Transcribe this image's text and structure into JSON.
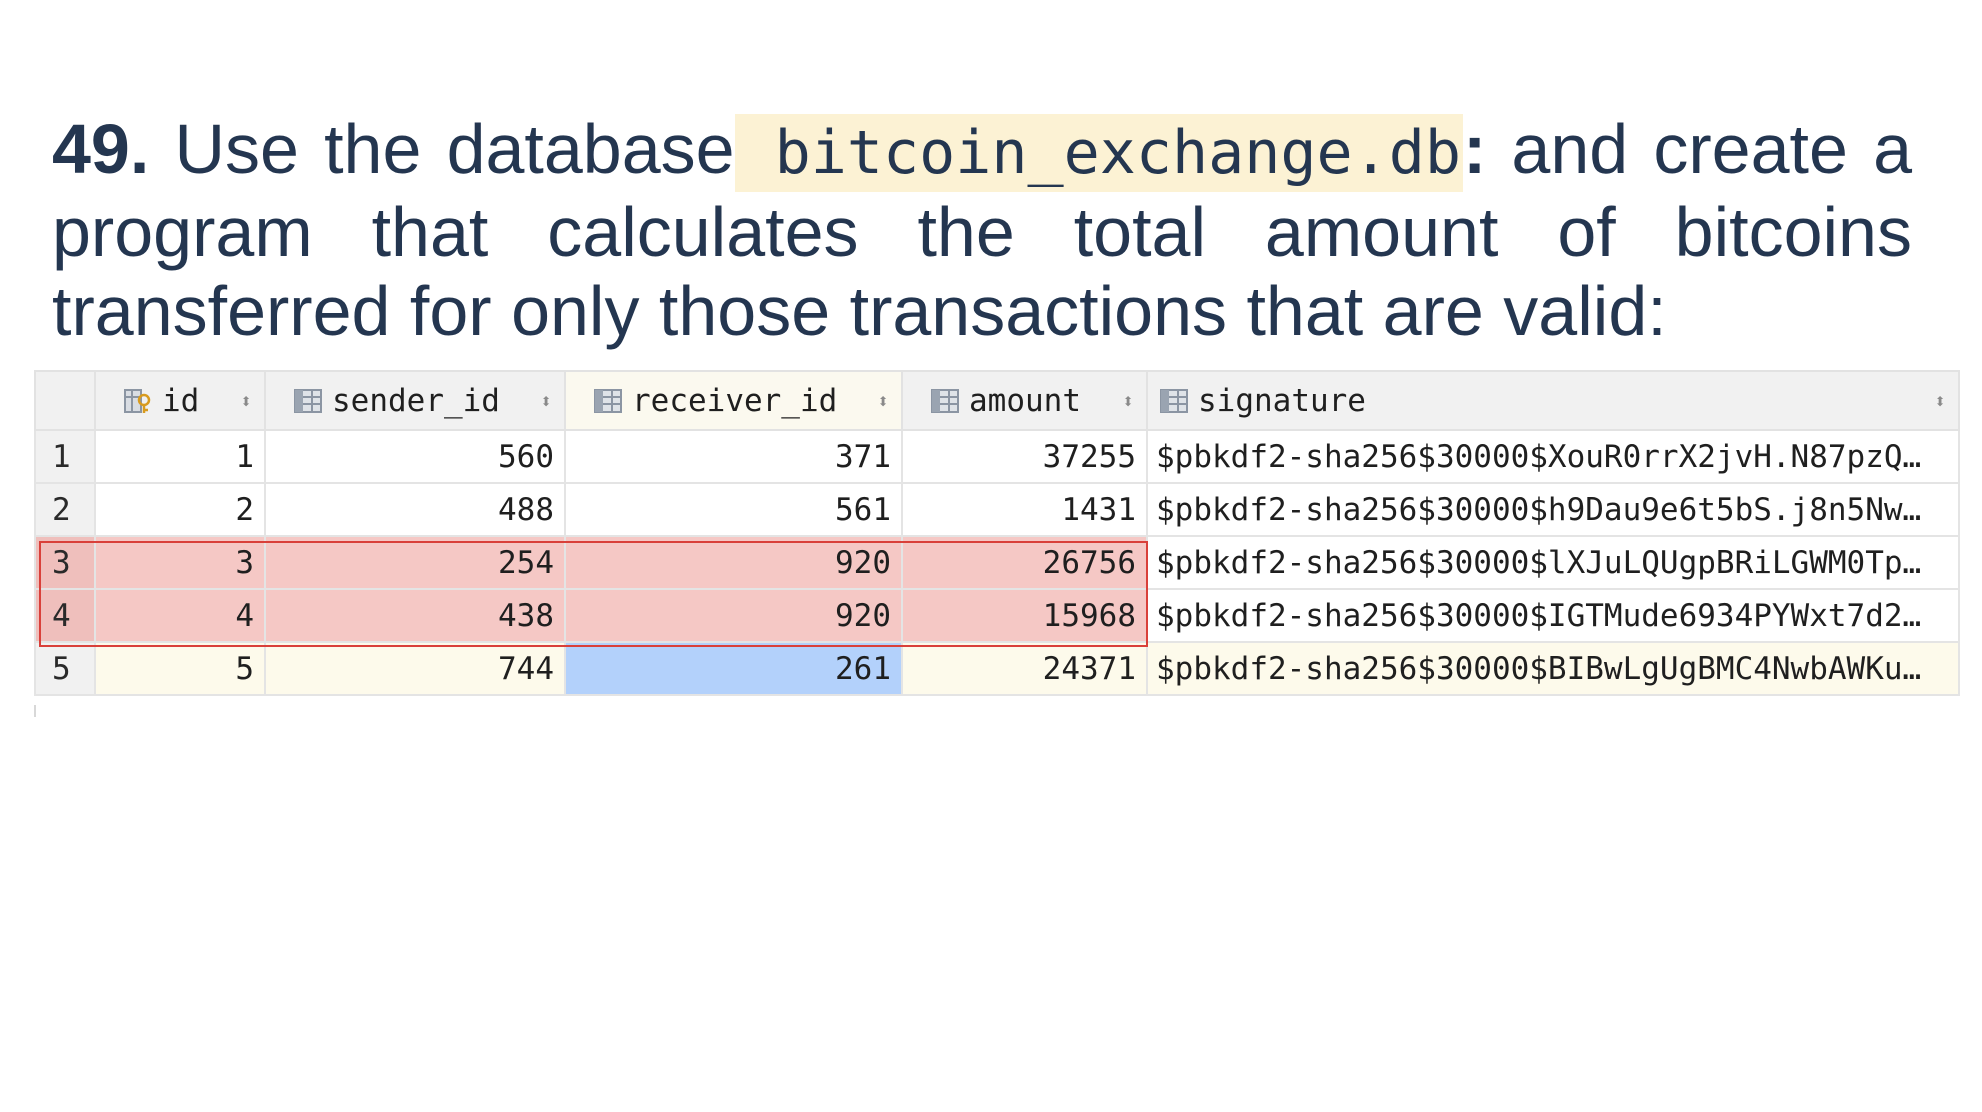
{
  "exercise": {
    "number": "49.",
    "text_before": "Use the database",
    "database_name": "bitcoin_exchange.db",
    "colon": ":",
    "text_after": "and create a program that calculates the total amount of bitcoins transferred for only those transactions that are valid:"
  },
  "table": {
    "columns": [
      {
        "label": "id",
        "icon": "primary-key-column-icon"
      },
      {
        "label": "sender_id",
        "icon": "column-icon"
      },
      {
        "label": "receiver_id",
        "icon": "column-icon"
      },
      {
        "label": "amount",
        "icon": "column-icon"
      },
      {
        "label": "signature",
        "icon": "column-icon"
      }
    ],
    "sort_glyph": "⬍",
    "rows": [
      {
        "row_number": "1",
        "id": "1",
        "sender_id": "560",
        "receiver_id": "371",
        "amount": "37255",
        "signature": "$pbkdf2-sha256$30000$XouR0rrX2jvH.N87pzQ…"
      },
      {
        "row_number": "2",
        "id": "2",
        "sender_id": "488",
        "receiver_id": "561",
        "amount": "1431",
        "signature": "$pbkdf2-sha256$30000$h9Dau9e6t5bS.j8n5Nw…"
      },
      {
        "row_number": "3",
        "id": "3",
        "sender_id": "254",
        "receiver_id": "920",
        "amount": "26756",
        "signature": "$pbkdf2-sha256$30000$lXJuLQUgpBRiLGWM0Tp…"
      },
      {
        "row_number": "4",
        "id": "4",
        "sender_id": "438",
        "receiver_id": "920",
        "amount": "15968",
        "signature": "$pbkdf2-sha256$30000$IGTMude6934PYWxt7d2…"
      },
      {
        "row_number": "5",
        "id": "5",
        "sender_id": "744",
        "receiver_id": "261",
        "amount": "24371",
        "signature": "$pbkdf2-sha256$30000$BIBwLgUgBMC4NwbAWKu…"
      }
    ]
  },
  "colors": {
    "text": "#243650",
    "db_highlight": "#fcf2d4",
    "flagged_rows": "#f5c8c5",
    "flag_border": "#d9403a",
    "selected_cell": "#b3d1fb",
    "active_row": "#fdfaeb",
    "header_bg": "#f1f1f1"
  }
}
